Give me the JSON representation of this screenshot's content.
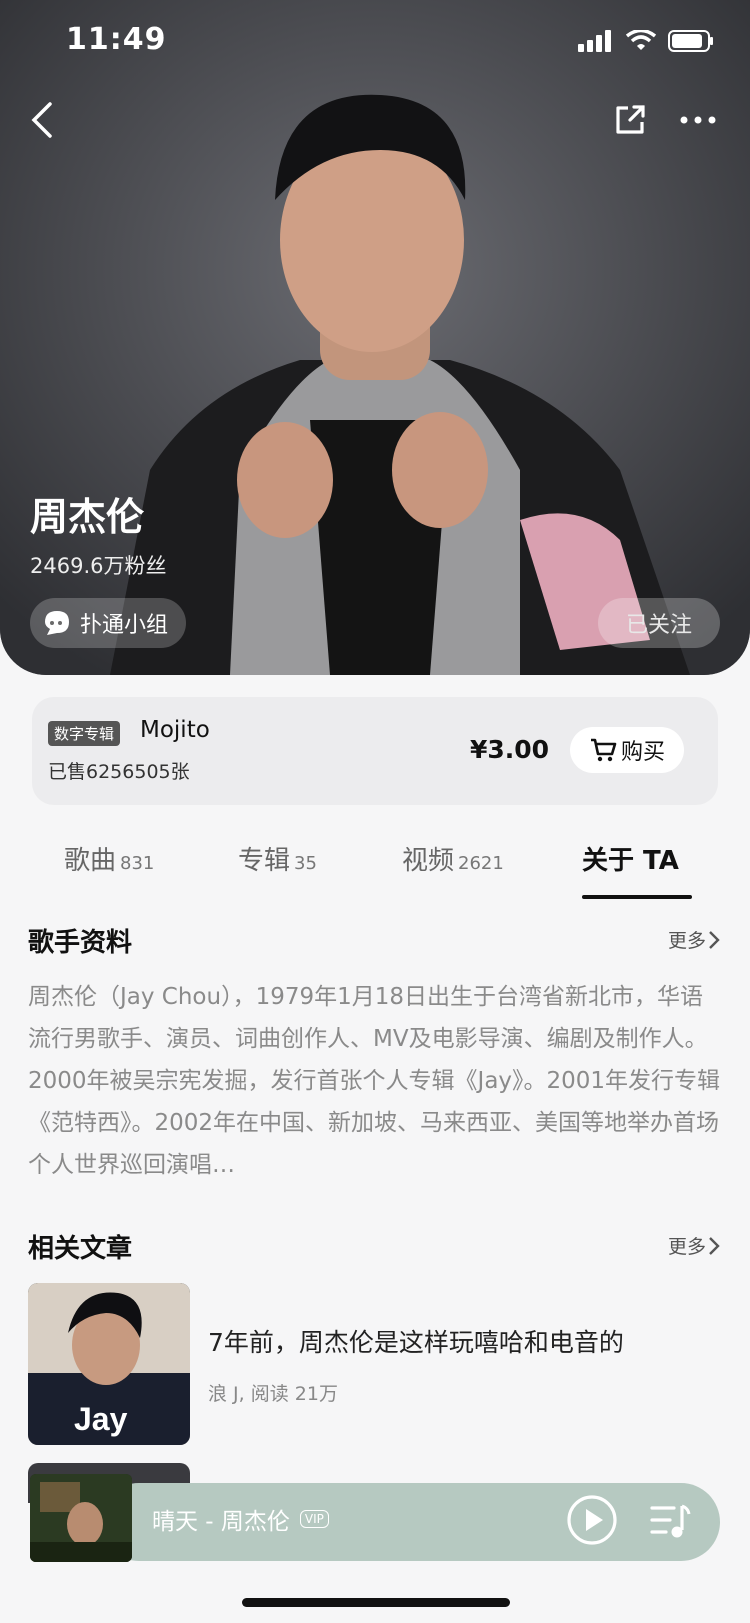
{
  "status_bar": {
    "time": "11:49"
  },
  "artist": {
    "name": "周杰伦",
    "fans": "2469.6万粉丝",
    "group_label": "扑通小组",
    "follow_label": "已关注"
  },
  "album": {
    "tag": "数字专辑",
    "name": "Mojito",
    "sold": "已售6256505张",
    "price": "¥3.00",
    "buy_label": "购买"
  },
  "tabs": [
    {
      "label": "歌曲",
      "count": "831"
    },
    {
      "label": "专辑",
      "count": "35"
    },
    {
      "label": "视频",
      "count": "2621"
    },
    {
      "label": "关于 TA",
      "count": ""
    }
  ],
  "profile": {
    "title": "歌手资料",
    "more": "更多",
    "bio": "周杰伦（Jay Chou），1979年1月18日出生于台湾省新北市，华语流行男歌手、演员、词曲创作人、MV及电影导演、编剧及制作人。2000年被吴宗宪发掘，发行首张个人专辑《Jay》。2001年发行专辑《范特西》。2002年在中国、新加坡、马来西亚、美国等地举办首场个人世界巡回演唱…"
  },
  "articles": {
    "title": "相关文章",
    "more": "更多",
    "items": [
      {
        "title": "7年前，周杰伦是这样玩嘻哈和电音的",
        "meta": "浪 J, 阅读 21万",
        "thumb_text": "Jay"
      }
    ]
  },
  "player": {
    "song": "晴天 - 周杰伦",
    "badge": "VIP"
  },
  "colors": {
    "player_bg": "#b6c9c1",
    "accent": "#111111"
  }
}
